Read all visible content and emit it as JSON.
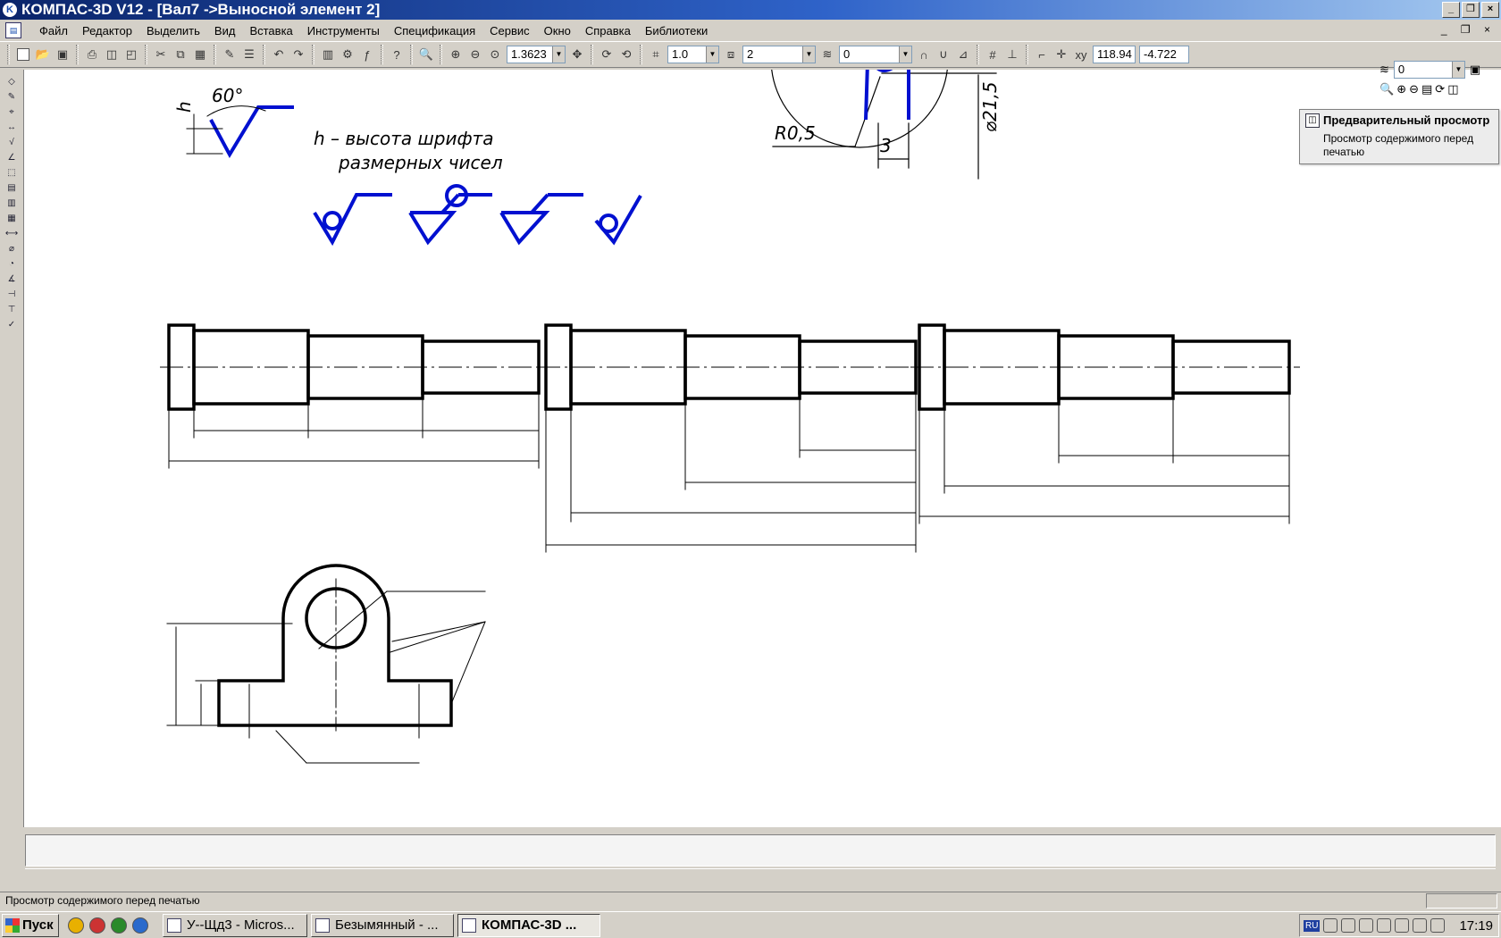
{
  "window": {
    "title": "КОМПАС-3D V12 - [Вал7 ->Выносной элемент 2]",
    "app_icon_letter": "K",
    "min_label": "_",
    "max_label": "❐",
    "close_label": "×"
  },
  "menu": [
    "Файл",
    "Редактор",
    "Выделить",
    "Вид",
    "Вставка",
    "Инструменты",
    "Спецификация",
    "Сервис",
    "Окно",
    "Справка",
    "Библиотеки"
  ],
  "mdi_controls": "_ ❐ ×",
  "toolbar": {
    "zoom": "1.3623",
    "step": "1.0",
    "view": "2",
    "layer": "0",
    "coord_x": "118.94",
    "coord_y": "-4.722"
  },
  "right_panel": {
    "layer_value": "0"
  },
  "tooltip": {
    "title": "Предварительный просмотр",
    "description": "Просмотр содержимого перед печатью"
  },
  "drawing": {
    "angle_label": "60°",
    "h_label": "h",
    "note_line1": "h – высота шрифта",
    "note_line2": "размерных чисел",
    "radius_label": "R0,5",
    "width_label": "3",
    "diameter_label": "⌀21,5"
  },
  "status": {
    "message": "Просмотр содержимого перед печатью"
  },
  "taskbar": {
    "start_label": "Пуск",
    "tasks": [
      {
        "label": "У--Щд3 - Micros..."
      },
      {
        "label": "Безымянный - ..."
      },
      {
        "label": "КОМПАС-3D ..."
      }
    ],
    "lang": "RU",
    "clock": "17:19"
  },
  "colors": {
    "title_bar": "#0a246a",
    "canvas": "#ffffff",
    "symbol_blue": "#0010d0"
  }
}
